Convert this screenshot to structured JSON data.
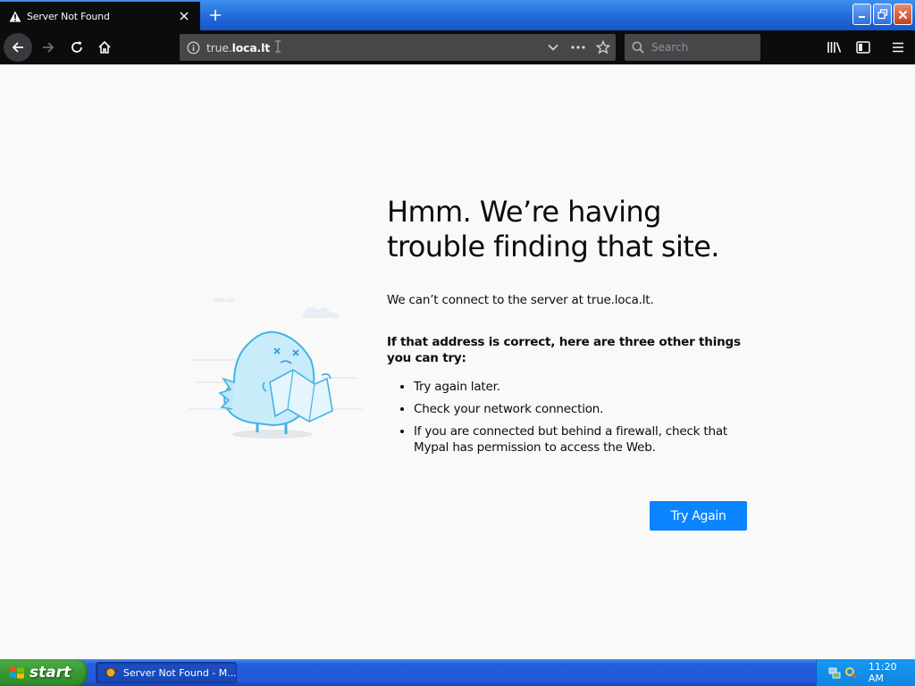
{
  "browser": {
    "tab": {
      "title": "Server Not Found"
    },
    "url": {
      "plain": "true.",
      "bold": "loca.lt"
    },
    "search": {
      "placeholder": "Search"
    }
  },
  "page": {
    "title": "Hmm. We’re having trouble finding that site.",
    "subtitle": "We can’t connect to the server at true.loca.lt.",
    "tips_heading": "If that address is correct, here are three other things you can try:",
    "tips": [
      "Try again later.",
      "Check your network connection.",
      "If you are connected but behind a firewall, check that Mypal has permission to access the Web."
    ],
    "try_again_label": "Try Again"
  },
  "taskbar": {
    "start_label": "start",
    "task_item": "Server Not Found - M...",
    "clock": "11:20 AM"
  },
  "colors": {
    "accent": "#0a84ff",
    "toolbar": "#0c0c0d",
    "urlbar": "#474749"
  }
}
